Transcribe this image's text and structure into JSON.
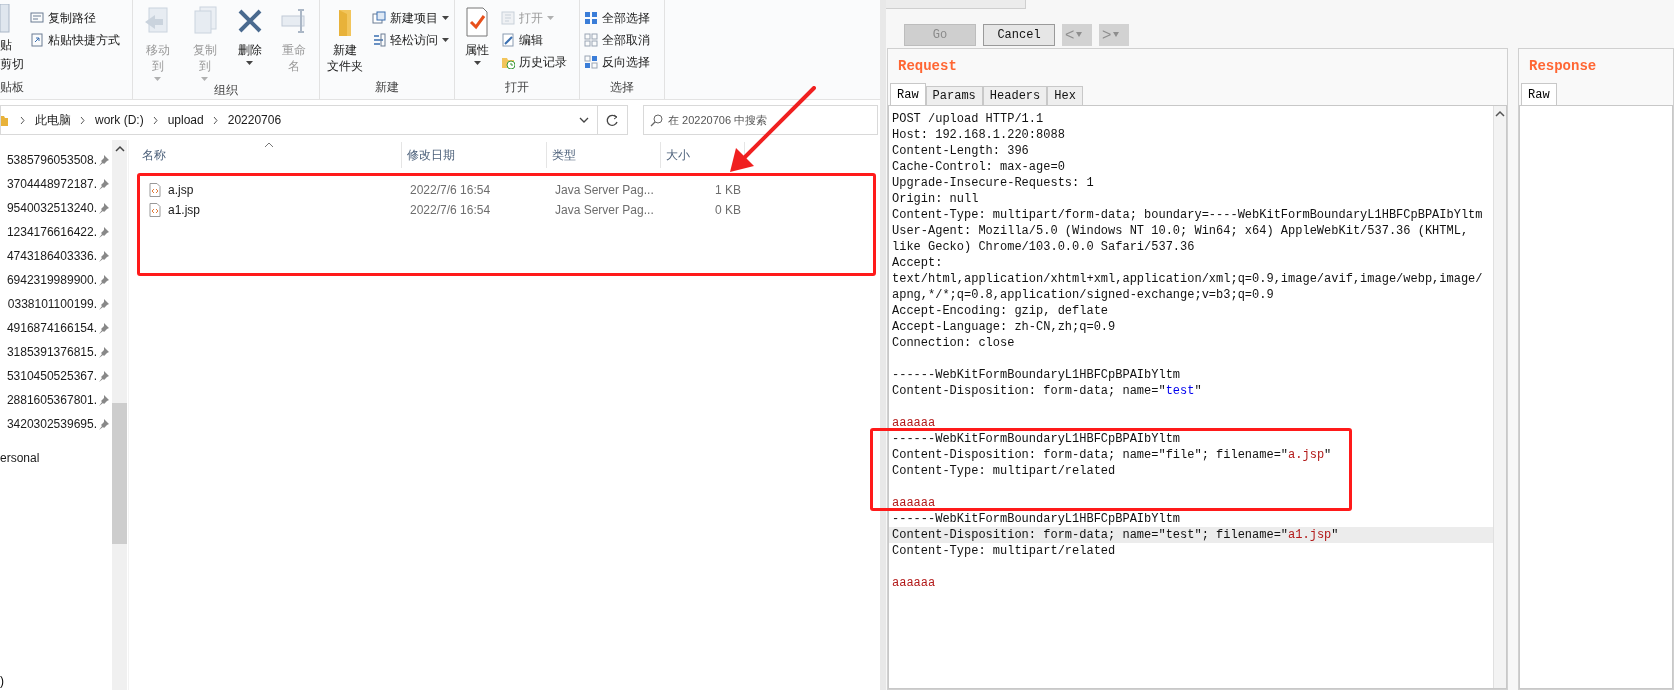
{
  "explorer": {
    "ribbon": {
      "groups": [
        {
          "label": "贴板",
          "items": [
            {
              "label": "贴",
              "kind": "stub"
            },
            {
              "label": "剪切",
              "kind": "stub"
            },
            {
              "label": "复制路径",
              "kind": "small",
              "disabled": false,
              "dropdown": false
            },
            {
              "label": "粘贴快捷方式",
              "kind": "small",
              "disabled": false,
              "dropdown": false
            }
          ]
        },
        {
          "label": "组织",
          "items": [
            {
              "label": "移动到",
              "kind": "large",
              "disabled": true,
              "dropdown": true
            },
            {
              "label": "复制到",
              "kind": "large",
              "disabled": true,
              "dropdown": true
            },
            {
              "label": "删除",
              "kind": "large",
              "disabled": false,
              "dropdown": true
            },
            {
              "label": "重命名",
              "kind": "large",
              "disabled": true,
              "dropdown": false
            }
          ]
        },
        {
          "label": "新建",
          "items": [
            {
              "label": "新建",
              "label_line_2": "文件夹",
              "kind": "large",
              "disabled": false,
              "dropdown": false
            },
            {
              "label": "新建项目",
              "kind": "small",
              "disabled": false,
              "dropdown": true
            },
            {
              "label": "轻松访问",
              "kind": "small",
              "disabled": false,
              "dropdown": true
            }
          ]
        },
        {
          "label": "打开",
          "items": [
            {
              "label": "属性",
              "kind": "large",
              "disabled": false,
              "dropdown": true
            },
            {
              "label": "打开",
              "kind": "small",
              "disabled": true,
              "dropdown": true
            },
            {
              "label": "编辑",
              "kind": "small",
              "disabled": false,
              "dropdown": false
            },
            {
              "label": "历史记录",
              "kind": "small",
              "disabled": false,
              "dropdown": false
            }
          ]
        },
        {
          "label": "选择",
          "items": [
            {
              "label": "全部选择",
              "kind": "small",
              "disabled": false,
              "dropdown": false
            },
            {
              "label": "全部取消",
              "kind": "small",
              "disabled": false,
              "dropdown": false
            },
            {
              "label": "反向选择",
              "kind": "small",
              "disabled": false,
              "dropdown": false
            }
          ]
        }
      ]
    },
    "breadcrumbs": [
      "此电脑",
      "work (D:)",
      "upload",
      "20220706"
    ],
    "search": {
      "placeholder": "在 20220706 中搜索"
    },
    "nav_items": [
      {
        "label": "5385796053508.",
        "pinned": true
      },
      {
        "label": "3704448972187.",
        "pinned": true
      },
      {
        "label": "9540032513240.",
        "pinned": true
      },
      {
        "label": "1234176616422.",
        "pinned": true
      },
      {
        "label": "4743186403336.",
        "pinned": true
      },
      {
        "label": "6942319989900.",
        "pinned": true
      },
      {
        "label": "0338101100199.",
        "pinned": true
      },
      {
        "label": "4916874166154.",
        "pinned": true
      },
      {
        "label": "3185391376815.",
        "pinned": true
      },
      {
        "label": "5310450525367.",
        "pinned": true
      },
      {
        "label": "2881605367801.",
        "pinned": true
      },
      {
        "label": "3420302539695.",
        "pinned": true
      },
      {
        "label": "ersonal",
        "pinned": false
      }
    ],
    "nav_footer": ")",
    "columns": [
      {
        "label": "名称",
        "sorted": true
      },
      {
        "label": "修改日期",
        "sorted": false
      },
      {
        "label": "类型",
        "sorted": false
      },
      {
        "label": "大小",
        "sorted": false
      }
    ],
    "files": [
      {
        "name": "a.jsp",
        "modified": "2022/7/6 16:54",
        "type": "Java Server Pag...",
        "size": "1 KB"
      },
      {
        "name": "a1.jsp",
        "modified": "2022/7/6 16:54",
        "type": "Java Server Pag...",
        "size": "0 KB"
      }
    ]
  },
  "repeater": {
    "buttons": [
      {
        "label": "Go",
        "disabled": true
      },
      {
        "label": "Cancel",
        "disabled": false
      }
    ],
    "history": [
      {
        "label": "<",
        "disabled": true
      },
      {
        "label": ">",
        "disabled": true
      }
    ],
    "request": {
      "title": "Request",
      "tabs": [
        {
          "label": "Raw",
          "selected": true
        },
        {
          "label": "Params",
          "selected": false
        },
        {
          "label": "Headers",
          "selected": false
        },
        {
          "label": "Hex",
          "selected": false
        }
      ],
      "lines": [
        {
          "kind": "text",
          "current": false,
          "parts": [
            {
              "kind": "plain",
              "text": "POST /upload HTTP/1.1"
            }
          ]
        },
        {
          "kind": "text",
          "current": false,
          "parts": [
            {
              "kind": "plain",
              "text": "Host: 192.168.1.220:8088"
            }
          ]
        },
        {
          "kind": "text",
          "current": false,
          "parts": [
            {
              "kind": "plain",
              "text": "Content-Length: 396"
            }
          ]
        },
        {
          "kind": "text",
          "current": false,
          "parts": [
            {
              "kind": "plain",
              "text": "Cache-Control: max-age=0"
            }
          ]
        },
        {
          "kind": "text",
          "current": false,
          "parts": [
            {
              "kind": "plain",
              "text": "Upgrade-Insecure-Requests: 1"
            }
          ]
        },
        {
          "kind": "text",
          "current": false,
          "parts": [
            {
              "kind": "plain",
              "text": "Origin: null"
            }
          ]
        },
        {
          "kind": "text",
          "current": false,
          "parts": [
            {
              "kind": "plain",
              "text": "Content-Type: multipart/form-data; boundary=----WebKitFormBoundaryL1HBFCpBPAIbYltm"
            }
          ]
        },
        {
          "kind": "text",
          "current": false,
          "parts": [
            {
              "kind": "plain",
              "text": "User-Agent: Mozilla/5.0 (Windows NT 10.0; Win64; x64) AppleWebKit/537.36 (KHTML,"
            }
          ]
        },
        {
          "kind": "text",
          "current": false,
          "parts": [
            {
              "kind": "plain",
              "text": "like Gecko) Chrome/103.0.0.0 Safari/537.36"
            }
          ]
        },
        {
          "kind": "text",
          "current": false,
          "parts": [
            {
              "kind": "plain",
              "text": "Accept:"
            }
          ]
        },
        {
          "kind": "text",
          "current": false,
          "parts": [
            {
              "kind": "plain",
              "text": "text/html,application/xhtml+xml,application/xml;q=0.9,image/avif,image/webp,image/"
            }
          ]
        },
        {
          "kind": "text",
          "current": false,
          "parts": [
            {
              "kind": "plain",
              "text": "apng,*/*;q=0.8,application/signed-exchange;v=b3;q=0.9"
            }
          ]
        },
        {
          "kind": "text",
          "current": false,
          "parts": [
            {
              "kind": "plain",
              "text": "Accept-Encoding: gzip, deflate"
            }
          ]
        },
        {
          "kind": "text",
          "current": false,
          "parts": [
            {
              "kind": "plain",
              "text": "Accept-Language: zh-CN,zh;q=0.9"
            }
          ]
        },
        {
          "kind": "text",
          "current": false,
          "parts": [
            {
              "kind": "plain",
              "text": "Connection: close"
            }
          ]
        },
        {
          "kind": "blank",
          "current": false
        },
        {
          "kind": "text",
          "current": false,
          "parts": [
            {
              "kind": "plain",
              "text": "------WebKitFormBoundaryL1HBFCpBPAIbYltm"
            }
          ]
        },
        {
          "kind": "text",
          "current": false,
          "parts": [
            {
              "kind": "plain",
              "text": "Content-Disposition: form-data; name=\""
            },
            {
              "kind": "param",
              "text": "test"
            },
            {
              "kind": "plain",
              "text": "\""
            }
          ]
        },
        {
          "kind": "blank",
          "current": false
        },
        {
          "kind": "text",
          "current": false,
          "parts": [
            {
              "kind": "value",
              "text": "aaaaaa"
            }
          ]
        },
        {
          "kind": "text",
          "current": false,
          "parts": [
            {
              "kind": "plain",
              "text": "------WebKitFormBoundaryL1HBFCpBPAIbYltm"
            }
          ]
        },
        {
          "kind": "text",
          "current": false,
          "parts": [
            {
              "kind": "plain",
              "text": "Content-Disposition: form-data; name=\"file\"; filename=\""
            },
            {
              "kind": "value",
              "text": "a.jsp"
            },
            {
              "kind": "plain",
              "text": "\""
            }
          ]
        },
        {
          "kind": "text",
          "current": false,
          "parts": [
            {
              "kind": "plain",
              "text": "Content-Type: multipart/related"
            }
          ]
        },
        {
          "kind": "blank",
          "current": false
        },
        {
          "kind": "text",
          "current": false,
          "parts": [
            {
              "kind": "value",
              "text": "aaaaaa"
            }
          ]
        },
        {
          "kind": "text",
          "current": false,
          "parts": [
            {
              "kind": "plain",
              "text": "------WebKitFormBoundaryL1HBFCpBPAIbYltm"
            }
          ]
        },
        {
          "kind": "text",
          "current": true,
          "parts": [
            {
              "kind": "plain",
              "text": "Content-Disposition: form-data; name=\"test\"; filename=\""
            },
            {
              "kind": "value",
              "text": "a1.jsp"
            },
            {
              "kind": "plain",
              "text": "\""
            }
          ]
        },
        {
          "kind": "text",
          "current": false,
          "parts": [
            {
              "kind": "plain",
              "text": "Content-Type: multipart/related"
            }
          ]
        },
        {
          "kind": "blank",
          "current": false
        },
        {
          "kind": "text",
          "current": false,
          "parts": [
            {
              "kind": "value",
              "text": "aaaaaa"
            }
          ]
        }
      ]
    },
    "response": {
      "title": "Response",
      "tabs": [
        {
          "label": "Raw",
          "selected": true
        }
      ]
    }
  },
  "annotations": [
    {
      "kind": "highlight_box"
    },
    {
      "kind": "highlight_box"
    },
    {
      "kind": "arrow"
    }
  ]
}
